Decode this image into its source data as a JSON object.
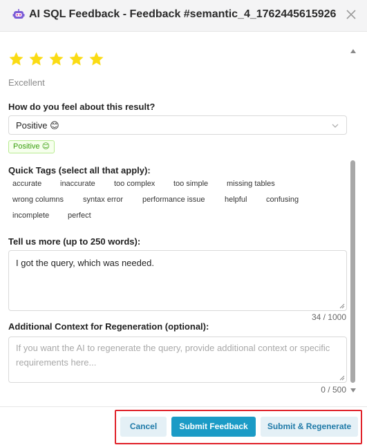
{
  "header": {
    "title": "AI SQL Feedback - Feedback #semantic_4_1762445615926",
    "logo_icon": "robot-icon",
    "close_icon": "close-icon"
  },
  "rating": {
    "stars_filled": 5,
    "stars_total": 5,
    "label": "Excellent",
    "star_color": "#fadb14"
  },
  "sentiment": {
    "question": "How do you feel about this result?",
    "selected": "Positive 😊",
    "badge": "Positive 😊"
  },
  "quick_tags": {
    "label": "Quick Tags (select all that apply):",
    "items": [
      "accurate",
      "inaccurate",
      "too complex",
      "too simple",
      "missing tables",
      "wrong columns",
      "syntax error",
      "performance issue",
      "helpful",
      "confusing",
      "incomplete",
      "perfect"
    ]
  },
  "details": {
    "label": "Tell us more (up to 250 words):",
    "value": "I got the query, which was needed.",
    "counter": "34 / 1000"
  },
  "context": {
    "label": "Additional Context for Regeneration (optional):",
    "placeholder": "If you want the AI to regenerate the query, provide additional context or specific requirements here...",
    "counter": "0 / 500"
  },
  "footer": {
    "cancel_label": "Cancel",
    "submit_label": "Submit Feedback",
    "regenerate_label": "Submit & Regenerate",
    "primary_color": "#1b9bc6",
    "highlight_color": "#e0222a"
  }
}
